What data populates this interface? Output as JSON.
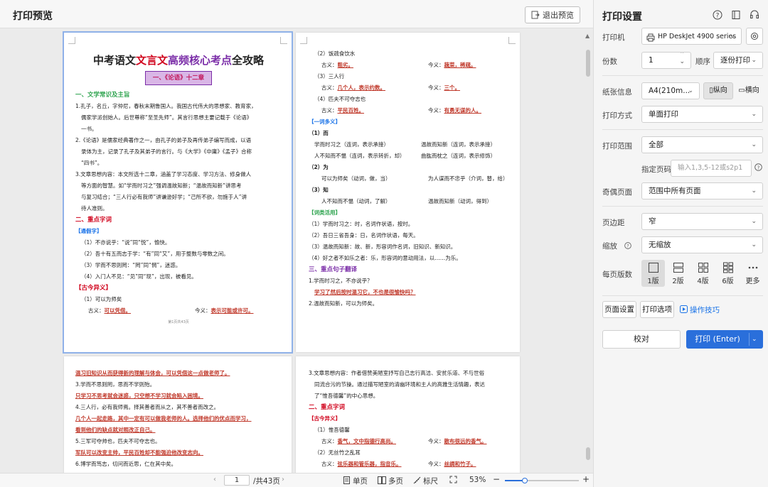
{
  "app": {
    "title": "打印预览",
    "exit_label": "退出预览"
  },
  "pages": {
    "p1": {
      "title": {
        "a": "中考语文",
        "b": "文言文",
        "c": "高频核心考点",
        "d": "全攻略"
      },
      "banner": "一、《论语》十二章",
      "s1": "一、文学常识及主旨",
      "l1": "1.孔子，名丘，字仲尼，春秋末期鲁国人。我国古代伟大的思想家、教育家，",
      "l2": "儒家学派创始人。后世尊称“至圣先师”。其言行思想主要记载于《论语》",
      "l3": "一书。",
      "l4": "2.《论语》是儒家经典著作之一，由孔子的弟子及再传弟子编写而成，以语",
      "l5": "录体为主，记录了孔子及其弟子的言行。与《大学》《中庸》《孟子》合称",
      "l6": "“四书”。",
      "l7": "3.文章思想内容：本文所选十二章，涵盖了学习态度、学习方法、修身做人",
      "l8": "等方面的智慧。如“学而时习之”强调温故知新；“温故而知新”讲思考",
      "l9": "与复习结合；“三人行必有我师”讲谦逊好学；“己所不欲，勿施于人”讲",
      "l10": "待人准则。",
      "s2": "二、重点字词",
      "t1": "【通假字】",
      "l11": "（1）不亦说乎：“说”同“悦”，愉快。",
      "l12": "（2）吾十有五而志于学：“有”同“又”，用于整数与零数之间。",
      "l13": "（3）学而不思则罔：“罔”同“惘”，迷惑。",
      "l14": "（4）入门人不见：“见”同“现”，出现，被看见。",
      "t2": "【古今异义】",
      "l15": "（1）可以为师矣",
      "l16a": "古义：",
      "l16b": "可以凭借。",
      "l16c": "今义：",
      "l16d": "表示可能或许可。",
      "foot": "第1页共43页"
    },
    "p2": {
      "l1": "（2）饭疏食饮水",
      "l2a": "古义：",
      "l2b": "粗劣。",
      "l2c": "今义：",
      "l2d": "蔬菜，稀疏。",
      "l3": "（3）三人行",
      "l4a": "古义：",
      "l4b": "几个人，表示约数。",
      "l4c": "今义：",
      "l4d": "三个。",
      "l5": "（4）匹夫不可夺志也",
      "l6a": "古义：",
      "l6b": "平民百姓。",
      "l6c": "今义：",
      "l6d": "有勇无谋的人。",
      "t1": "【一词多义】",
      "w1": "（1）而",
      "l7a": "学而时习之（连词，表示承接）",
      "l7b": "温故而知新（连词，表示承接）",
      "l8a": "人不知而不愠（连词，表示转折，却）",
      "l8b": "曲肱而枕之（连词，表示修饰）",
      "w2": "（2）为",
      "l9a": "可以为师矣（动词，做，当）",
      "l9b": "为人谋而不忠乎（介词，替，给）",
      "w3": "（3）知",
      "l10a": "人不知而不愠（动词，了解）",
      "l10b": "温故而知新（动词，得到）",
      "t2": "【词类活用】",
      "l11": "（1）学而时习之：时，名词作状语，按时。",
      "l12": "（2）吾日三省吾身：日，名词作状语，每天。",
      "l13": "（3）温故而知新：故、新，形容词作名词，旧知识、新知识。",
      "l14": "（4）好之者不如乐之者：乐，形容词的意动用法，以……为乐。",
      "s3": "三、重点句子翻译",
      "l15": "1.学而时习之，不亦说乎？",
      "l16": "学习了然后按时温习它，不也是很愉快吗？",
      "l17": "2.温故而知新，可以为师矣。"
    },
    "p3": {
      "l1": "温习旧知识从而获得新的理解与体会，可以凭借这一点做老师了。",
      "l2": "3.学而不思则罔，思而不学则殆。",
      "l3": "只学习不思考就会迷惑，只空想不学习就会陷入困境。",
      "l4": "4.三人行，必有我师焉。择其善者而从之，其不善者而改之。",
      "l5": "几个人一起走路，其中一定有可以做我老师的人。选择他们的优点而学习，",
      "l6": "看到他们的缺点就对照改正自己。",
      "l7": "5.三军可夺帅也，匹夫不可夺志也。",
      "l8": "军队可以改变主帅，平民百姓却不能强迫他改变志向。",
      "l9": "6.博学而笃志，切问而近思，仁在其中矣。"
    },
    "p4": {
      "l1": "3.文章思想内容：作者借赞美陋室抒写自己志行高洁、安贫乐道、不与世俗",
      "l2": "同流合污的节操。通过描写陋室的清幽环境和主人的高雅生活情趣，表达",
      "l3": "了“惟吾德馨”的中心思想。",
      "s2": "二、重点字词",
      "t1": "【古今异义】",
      "l4": "（1）惟吾德馨",
      "l5a": "古义：",
      "l5b": "香气，文中指德行高尚。",
      "l5c": "今义：",
      "l5d": "散布很远的香气。",
      "l6": "（2）无丝竹之乱耳",
      "l7a": "古义：",
      "l7b": "弦乐器和管乐器，指音乐。",
      "l7c": "今义：",
      "l7d": "丝绸和竹子。"
    }
  },
  "bottombar": {
    "page_current": "1",
    "page_total": "/共43页",
    "single": "单页",
    "multi": "多页",
    "ruler": "标尺",
    "zoom": "53%",
    "zoom_level": 0.27
  },
  "settings": {
    "title": "打印设置",
    "printer_label": "打印机",
    "printer_value": "HP DeskJet 4900 series",
    "copies_label": "份数",
    "copies_value": "1",
    "order_label": "顺序",
    "order_value": "逐份打印",
    "paper_label": "纸张信息",
    "paper_value": "A4(210m...",
    "portrait": "纵向",
    "landscape": "横向",
    "mode_label": "打印方式",
    "mode_value": "单面打印",
    "range_label": "打印范围",
    "range_value": "全部",
    "pages_label": "指定页码",
    "pages_placeholder": "输入1,3,5-12或s2p1",
    "oddeven_label": "奇偶页面",
    "oddeven_value": "范围中所有页面",
    "margin_label": "页边距",
    "margin_value": "窄",
    "scale_label": "缩放",
    "scale_value": "无缩放",
    "perpage_label": "每页版数",
    "layouts": [
      "1版",
      "2版",
      "4版",
      "6版",
      "更多"
    ],
    "page_setup": "页面设置",
    "print_options": "打印选项",
    "tips": "操作技巧",
    "proof": "校对",
    "print": "打印 (Enter)"
  },
  "colors": {
    "accent": "#2a6fdb",
    "answer": "#c0392b",
    "heading_green": "#2ea44f",
    "heading_red": "#d0021b"
  }
}
